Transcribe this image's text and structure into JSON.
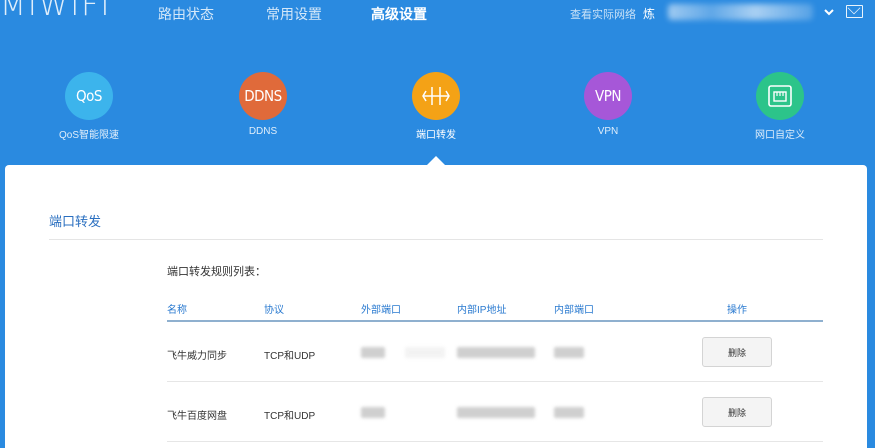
{
  "header": {
    "logo": "MIWIFI",
    "tabs": [
      {
        "label": "路由状态",
        "active": false
      },
      {
        "label": "常用设置",
        "active": false
      },
      {
        "label": "高级设置",
        "active": true
      }
    ],
    "bandwidth_link": "查看实际网络",
    "user_name": "炼",
    "icons": {
      "dropdown": "chevron-down-icon",
      "message": "mail-icon"
    }
  },
  "tools": [
    {
      "icon_text": "QoS",
      "label": "QoS智能限速",
      "color": "#3cb4ec"
    },
    {
      "icon_text": "DDNS",
      "label": "DDNS",
      "color": "#e06a3a"
    },
    {
      "icon_text": "",
      "label": "端口转发",
      "color": "#f4a216",
      "icon": "port-forward-icon",
      "active": true
    },
    {
      "icon_text": "VPN",
      "label": "VPN",
      "color": "#a657d8"
    },
    {
      "icon_text": "",
      "label": "网口自定义",
      "color": "#2cc48a",
      "icon": "ethernet-port-icon"
    }
  ],
  "content": {
    "section_title": "端口转发",
    "list_caption": "端口转发规则列表：",
    "columns": [
      "名称",
      "协议",
      "外部端口",
      "内部IP地址",
      "内部端口",
      "操作"
    ],
    "rows": [
      {
        "name": "飞牛威力同步",
        "protocol": "TCP和UDP",
        "action": "删除"
      },
      {
        "name": "飞牛百度网盘",
        "protocol": "TCP和UDP",
        "action": "删除"
      }
    ]
  },
  "colors": {
    "background": "#2a8ae0",
    "accent_text": "#2a6fc0"
  }
}
